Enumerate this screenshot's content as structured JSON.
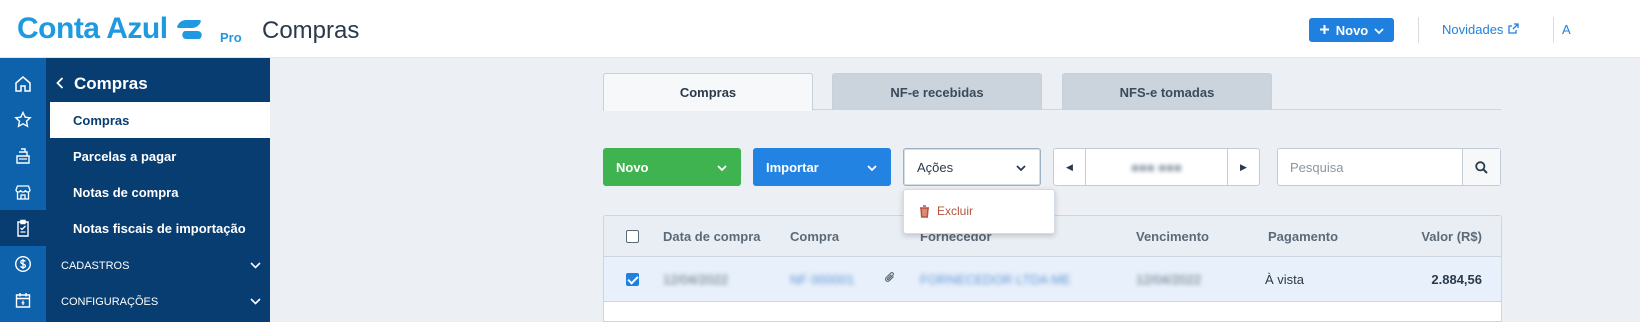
{
  "header": {
    "brand": "Conta Azul",
    "brand_tier": "Pro",
    "page_title": "Compras",
    "new_button": "Novo",
    "news_link": "Novidades",
    "more_link": "A"
  },
  "sidebar": {
    "rail_icons": [
      "home-icon",
      "star-icon",
      "cash-register-icon",
      "store-icon",
      "clipboard-icon",
      "dollar-icon",
      "calendar-icon"
    ],
    "back_title": "Compras",
    "items": [
      {
        "label": "Compras",
        "active": true
      },
      {
        "label": "Parcelas a pagar",
        "active": false
      },
      {
        "label": "Notas de compra",
        "active": false
      },
      {
        "label": "Notas fiscais de importação",
        "active": false
      }
    ],
    "groups": [
      {
        "label": "CADASTROS"
      },
      {
        "label": "CONFIGURAÇÕES"
      }
    ]
  },
  "tabs": [
    {
      "label": "Compras",
      "active": true
    },
    {
      "label": "NF-e recebidas",
      "active": false
    },
    {
      "label": "NFS-e tomadas",
      "active": false
    }
  ],
  "toolbar": {
    "new_label": "Novo",
    "import_label": "Importar",
    "actions_label": "Ações",
    "period_value": "■■■ ■■■",
    "search_placeholder": "Pesquisa"
  },
  "actions_menu": {
    "items": [
      {
        "label": "Excluir",
        "icon": "trash-icon"
      }
    ]
  },
  "table": {
    "columns": [
      "Data de compra",
      "Compra",
      "Fornecedor",
      "Vencimento",
      "Pagamento",
      "Valor (R$)"
    ],
    "rows": [
      {
        "checked": true,
        "date": "12/04/2022",
        "purchase": "NF 000001",
        "supplier": "FORNECEDOR LTDA ME",
        "due": "12/04/2022",
        "payment": "À vista",
        "value": "2.884,56",
        "has_attachment": true
      }
    ]
  },
  "colors": {
    "brand": "#1f9ae0",
    "sidebar_rail": "#0d62ab",
    "sidebar_panel": "#083d72",
    "green_button": "#3fb34f",
    "blue_button": "#2383e2",
    "danger": "#b5533f"
  }
}
